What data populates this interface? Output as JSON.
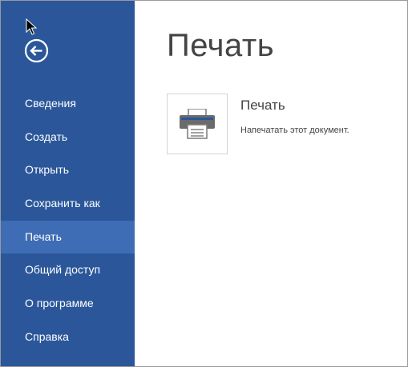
{
  "sidebar": {
    "back_icon": "back-arrow-circle-icon",
    "items": [
      {
        "label": "Сведения",
        "active": false
      },
      {
        "label": "Создать",
        "active": false
      },
      {
        "label": "Открыть",
        "active": false
      },
      {
        "label": "Сохранить как",
        "active": false
      },
      {
        "label": "Печать",
        "active": true
      },
      {
        "label": "Общий доступ",
        "active": false
      },
      {
        "label": "О программе",
        "active": false
      },
      {
        "label": "Справка",
        "active": false
      }
    ]
  },
  "main": {
    "title": "Печать",
    "print_option": {
      "icon": "printer-icon",
      "heading": "Печать",
      "description": "Напечатать этот документ."
    }
  },
  "colors": {
    "sidebar_bg": "#2b579a",
    "sidebar_active_bg": "#3e6db5",
    "text": "#444444"
  }
}
